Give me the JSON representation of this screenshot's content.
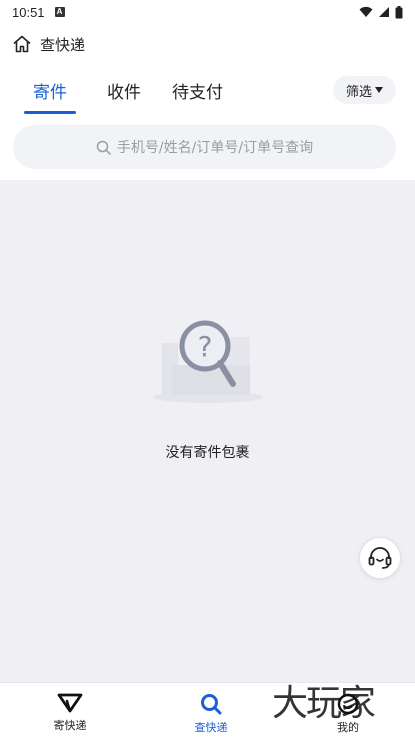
{
  "status_bar": {
    "time": "10:51",
    "indicator": "A"
  },
  "header": {
    "title": "查快递"
  },
  "tabs": [
    {
      "label": "寄件",
      "active": true
    },
    {
      "label": "收件",
      "active": false
    },
    {
      "label": "待支付",
      "active": false
    }
  ],
  "filter": {
    "label": "筛选"
  },
  "search": {
    "placeholder": "手机号/姓名/订单号/订单号查询"
  },
  "empty": {
    "message": "没有寄件包裹"
  },
  "tabbar": {
    "items": [
      {
        "label": "寄快递",
        "icon": "send-icon",
        "active": false
      },
      {
        "label": "查快递",
        "icon": "search-icon",
        "active": true
      },
      {
        "label": "我的",
        "icon": "profile-icon",
        "active": false
      }
    ]
  },
  "watermark": "大玩家",
  "colors": {
    "accent": "#1a5fd6",
    "background": "#efeff4"
  }
}
